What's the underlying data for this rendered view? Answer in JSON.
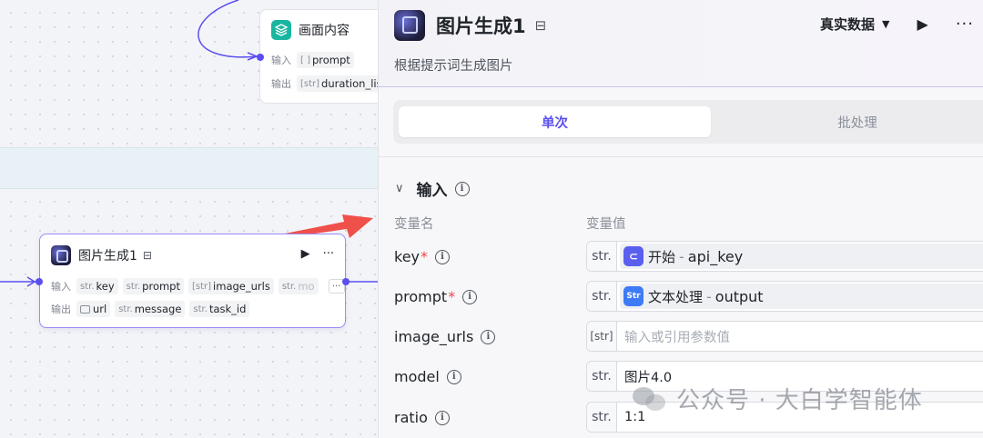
{
  "canvas": {
    "top_node": {
      "title": "画面内容",
      "input_label": "输入",
      "output_label": "输出",
      "inputs": [
        {
          "type": "[ ]",
          "name": "prompt"
        }
      ],
      "outputs": [
        {
          "type": "[str]",
          "name": "duration_list"
        }
      ]
    },
    "main_node": {
      "title": "图片生成1",
      "input_label": "输入",
      "output_label": "输出",
      "inputs": [
        {
          "type": "str.",
          "name": "key"
        },
        {
          "type": "str.",
          "name": "prompt"
        },
        {
          "type": "[str]",
          "name": "image_urls"
        },
        {
          "type": "str.",
          "name": "mo"
        }
      ],
      "more": "···",
      "outputs": [
        {
          "type": "",
          "name": "url"
        },
        {
          "type": "str.",
          "name": "message"
        },
        {
          "type": "str.",
          "name": "task_id"
        }
      ]
    }
  },
  "panel": {
    "title": "图片生成1",
    "description": "根据提示词生成图片",
    "mode_selector": "真实数据",
    "tabs": [
      {
        "label": "单次",
        "active": true
      },
      {
        "label": "批处理",
        "active": false
      }
    ],
    "section_title": "输入",
    "col_name": "变量名",
    "col_value": "变量值",
    "rows": [
      {
        "name": "key",
        "required": true,
        "type": "str.",
        "ref_source": "开始",
        "ref_field": "api_key",
        "ref_icon": "start-icon"
      },
      {
        "name": "prompt",
        "required": true,
        "type": "str.",
        "ref_source": "文本处理",
        "ref_field": "output",
        "ref_icon": "text-process-icon"
      },
      {
        "name": "image_urls",
        "required": false,
        "type": "[str]",
        "placeholder": "输入或引用参数值"
      },
      {
        "name": "model",
        "required": false,
        "type": "str.",
        "value": "图片4.0"
      },
      {
        "name": "ratio",
        "required": false,
        "type": "str.",
        "value": "1:1"
      }
    ]
  },
  "watermark": "公众号 · 大白学智能体",
  "colors": {
    "accent": "#5b4ff0",
    "arrow": "#f0504a",
    "teal": "#18b6a0"
  }
}
